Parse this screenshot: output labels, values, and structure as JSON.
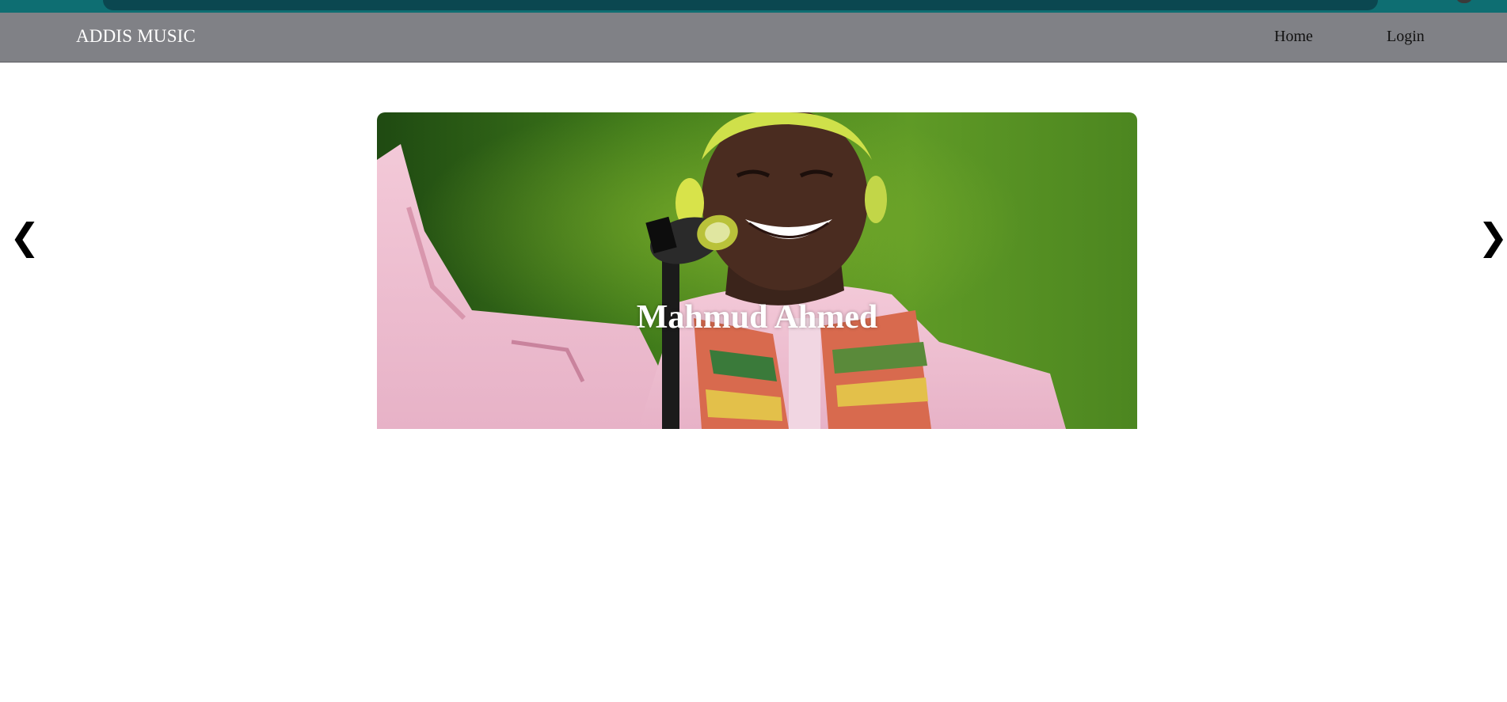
{
  "header": {
    "brand": "ADDIS MUSIC",
    "nav": [
      {
        "label": "Home"
      },
      {
        "label": "Login"
      }
    ]
  },
  "slider": {
    "caption": "Mahmud Ahmed",
    "prev_glyph": "❮",
    "next_glyph": "❯"
  },
  "colors": {
    "top_strip": "#0e6e72",
    "top_strip_inner": "#0b4750",
    "navbar": "#808186",
    "brand_text": "#ffffff",
    "nav_text": "#111111",
    "caption_text": "#ffffff",
    "slide_green": "#4f8a1f"
  }
}
